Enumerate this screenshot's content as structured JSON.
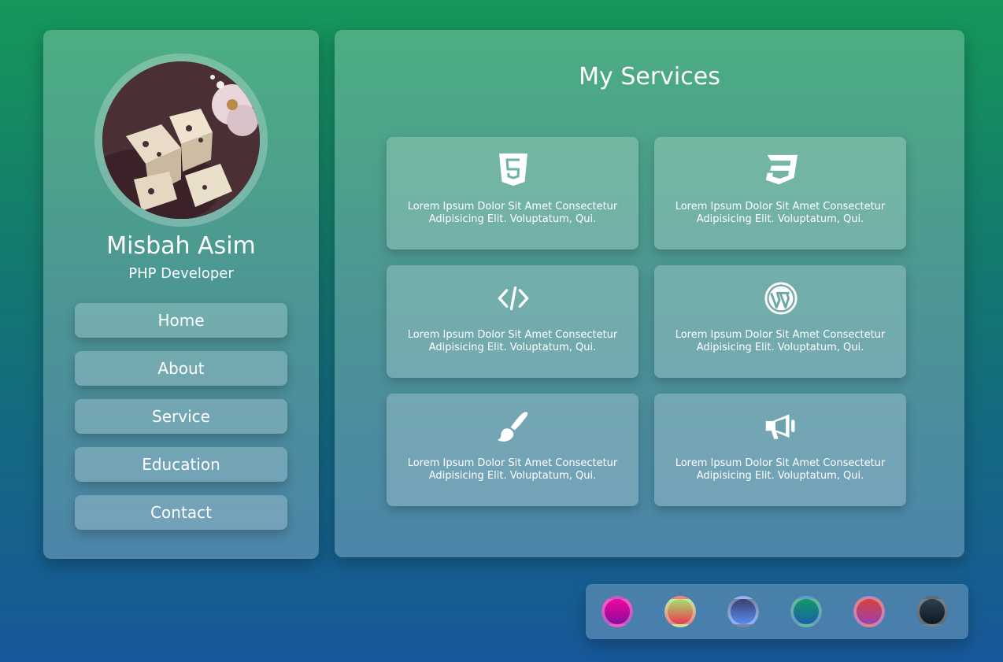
{
  "profile": {
    "name": "Misbah Asim",
    "role": "PHP Developer",
    "nav": [
      {
        "label": "Home"
      },
      {
        "label": "About"
      },
      {
        "label": "Service"
      },
      {
        "label": "Education"
      },
      {
        "label": "Contact"
      }
    ]
  },
  "services": {
    "title": "My Services",
    "items": [
      {
        "icon": "html5-icon",
        "text": "Lorem Ipsum Dolor Sit Amet Consectetur Adipisicing Elit. Voluptatum, Qui."
      },
      {
        "icon": "css3-icon",
        "text": "Lorem Ipsum Dolor Sit Amet Consectetur Adipisicing Elit. Voluptatum, Qui."
      },
      {
        "icon": "code-icon",
        "text": "Lorem Ipsum Dolor Sit Amet Consectetur Adipisicing Elit. Voluptatum, Qui."
      },
      {
        "icon": "wordpress-icon",
        "text": "Lorem Ipsum Dolor Sit Amet Consectetur Adipisicing Elit. Voluptatum, Qui."
      },
      {
        "icon": "paint-brush-icon",
        "text": "Lorem Ipsum Dolor Sit Amet Consectetur Adipisicing Elit. Voluptatum, Qui."
      },
      {
        "icon": "megaphone-icon",
        "text": "Lorem Ipsum Dolor Sit Amet Consectetur Adipisicing Elit. Voluptatum, Qui."
      }
    ]
  },
  "theme_swatches": [
    {
      "colors": [
        "#f0059a",
        "#8a0ba0"
      ]
    },
    {
      "colors": [
        "#a8e06e",
        "#e83a4e"
      ]
    },
    {
      "colors": [
        "#3a3f6e",
        "#5b8cf0"
      ]
    },
    {
      "colors": [
        "#0f9a6a",
        "#1d5fa8"
      ]
    },
    {
      "colors": [
        "#d7433d",
        "#9b3fb0"
      ]
    },
    {
      "colors": [
        "#2c3e50",
        "#0e1a22"
      ]
    }
  ],
  "colors": {
    "background_top": "#15985a",
    "background_bottom": "#17589a"
  }
}
